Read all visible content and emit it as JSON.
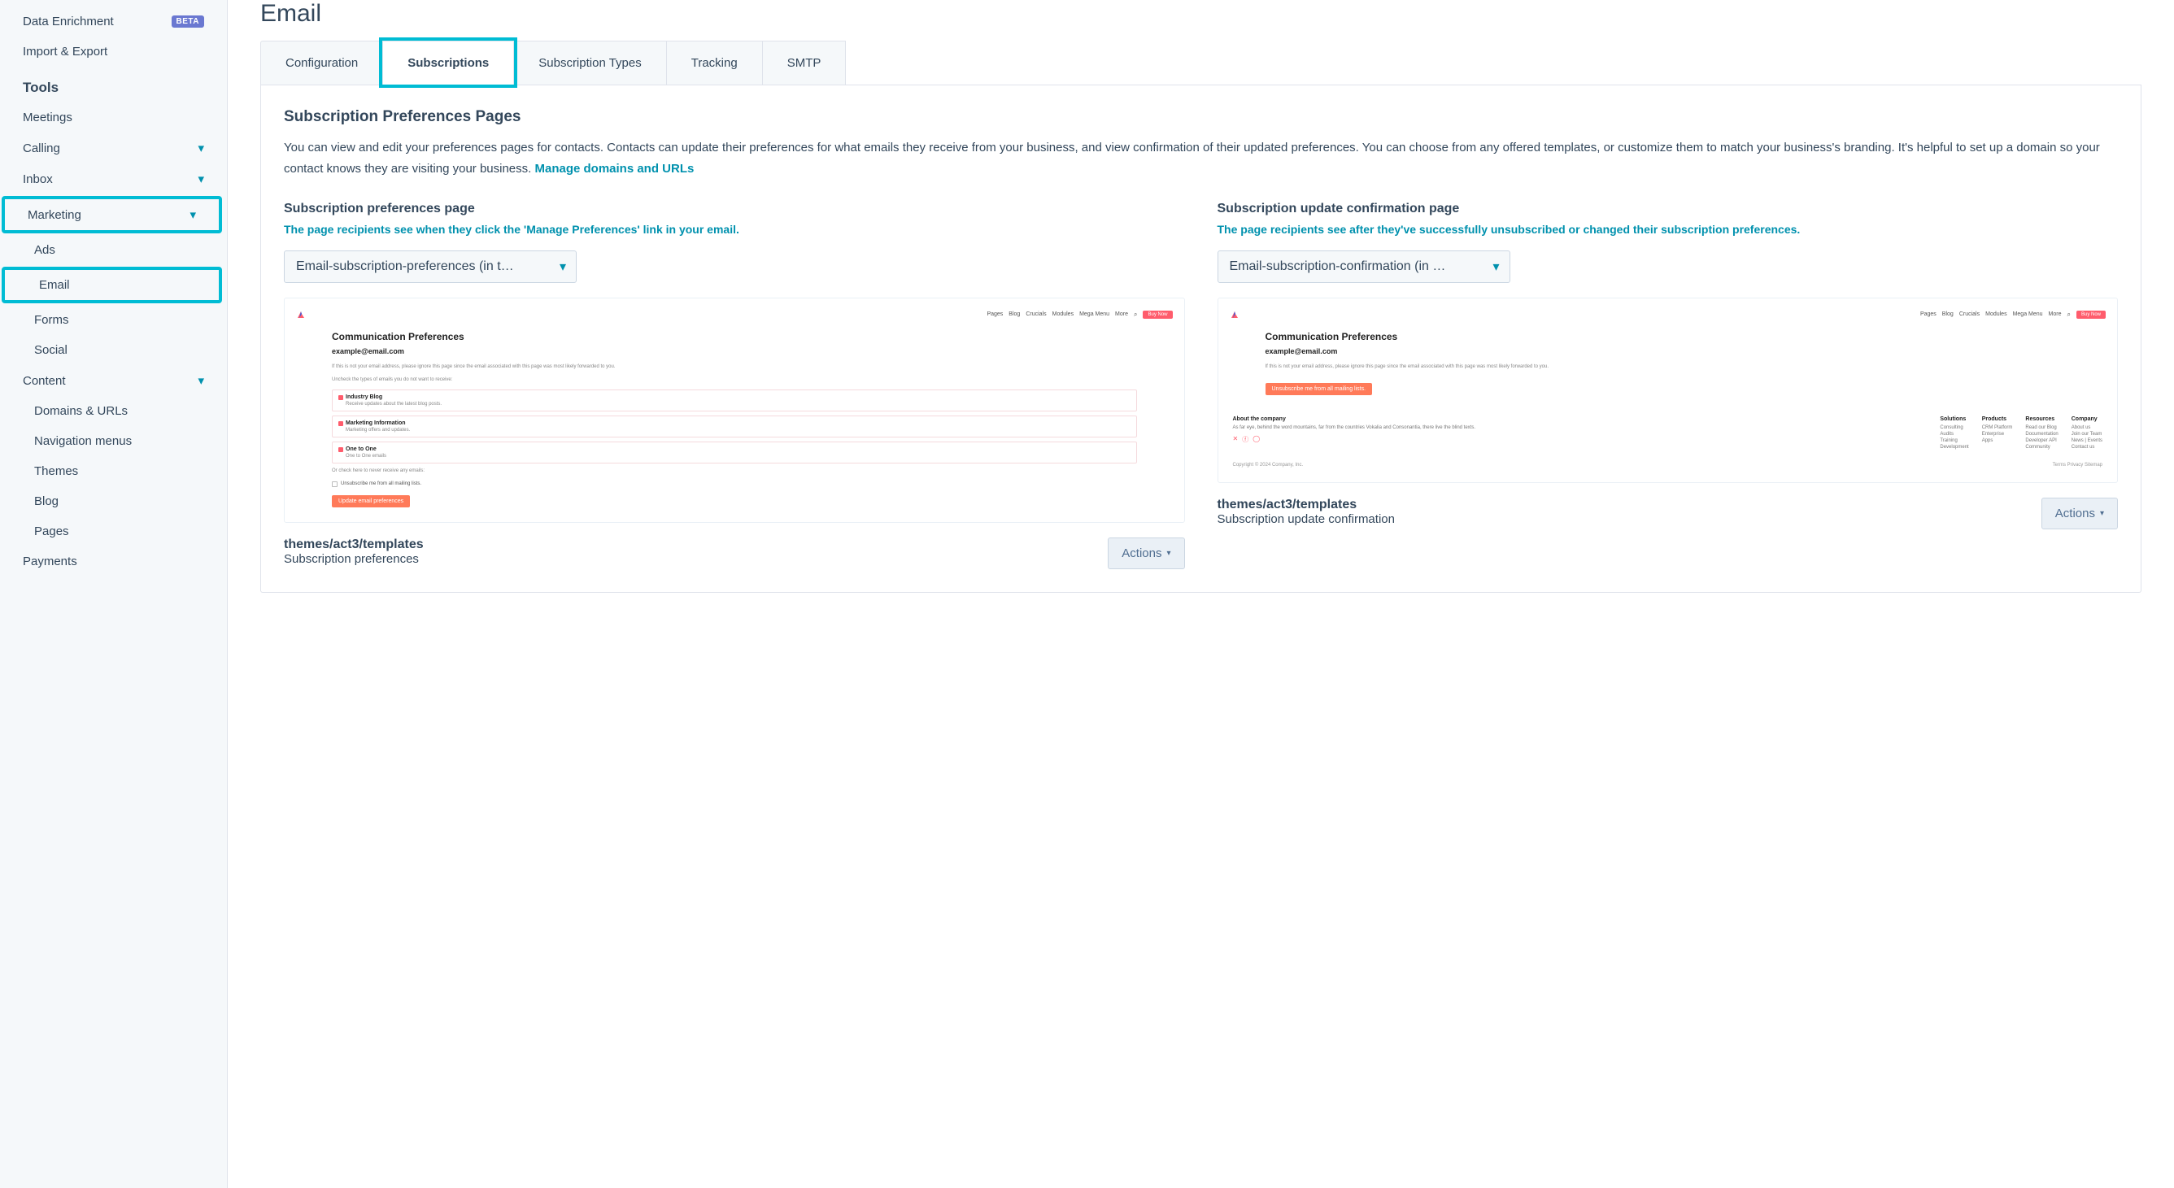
{
  "sidebar": {
    "dataEnrichment": "Data Enrichment",
    "betaBadge": "BETA",
    "importExport": "Import & Export",
    "toolsHeading": "Tools",
    "meetings": "Meetings",
    "calling": "Calling",
    "inbox": "Inbox",
    "marketing": "Marketing",
    "ads": "Ads",
    "email": "Email",
    "forms": "Forms",
    "social": "Social",
    "content": "Content",
    "domainsUrls": "Domains & URLs",
    "navMenus": "Navigation menus",
    "themes": "Themes",
    "blog": "Blog",
    "pages": "Pages",
    "payments": "Payments"
  },
  "page": {
    "title": "Email"
  },
  "tabs": {
    "configuration": "Configuration",
    "subscriptions": "Subscriptions",
    "subscriptionTypes": "Subscription Types",
    "tracking": "Tracking",
    "smtp": "SMTP"
  },
  "section": {
    "title": "Subscription Preferences Pages",
    "desc": "You can view and edit your preferences pages for contacts. Contacts can update their preferences for what emails they receive from your business, and view confirmation of their updated preferences. You can choose from any offered templates, or customize them to match your business's branding. It's helpful to set up a domain so your contact knows they are visiting your business. ",
    "manageLink": "Manage domains and URLs"
  },
  "left": {
    "title": "Subscription preferences page",
    "desc": "The page recipients see when they click the 'Manage Preferences' link in your email.",
    "select": "Email-subscription-preferences (in t…",
    "pathLine1": "themes/act3/templates",
    "pathLine2": "Subscription preferences",
    "actions": "Actions"
  },
  "right": {
    "title": "Subscription update confirmation page",
    "desc": "The page recipients see after they've successfully unsubscribed or changed their subscription preferences.",
    "select": "Email-subscription-confirmation (in …",
    "pathLine1": "themes/act3/templates",
    "pathLine2": "Subscription update confirmation",
    "actions": "Actions"
  },
  "preview": {
    "navItems": [
      "Pages",
      "Blog",
      "Crucials",
      "Modules",
      "Mega Menu",
      "More"
    ],
    "buyNow": "Buy Now",
    "heading": "Communication Preferences",
    "email": "example@email.com",
    "fine1": "If this is not your email address, please ignore this page since the email associated with this page was most likely forwarded to you.",
    "fine2": "Uncheck the types of emails you do not want to receive:",
    "card1t": "Industry Blog",
    "card1d": "Receive updates about the latest blog posts.",
    "card2t": "Marketing Information",
    "card2d": "Marketing offers and updates.",
    "card3t": "One to One",
    "card3d": "One to One emails",
    "orCheck": "Or check here to never receive any emails:",
    "unsubAll": "Unsubscribe me from all mailing lists.",
    "updateBtn": "Update email preferences",
    "unsubBtn": "Unsubscribe me from all mailing lists.",
    "footAboutH": "About the company",
    "footAboutT": "As far eye, behind the word mountains, far from the countries Vokalia and Consonantia, there live the blind texts.",
    "footSolH": "Solutions",
    "footSol": [
      "Consulting",
      "Audits",
      "Training",
      "Development"
    ],
    "footProdH": "Products",
    "footProd": [
      "CRM Platform",
      "Enterprise",
      "Apps"
    ],
    "footResH": "Resources",
    "footRes": [
      "Read our Blog",
      "Documentation",
      "Developer API",
      "Community"
    ],
    "footCompH": "Company",
    "footComp": [
      "About us",
      "Join our Team",
      "News | Events",
      "Contact us"
    ],
    "copyright": "Copyright © 2024 Company, Inc.",
    "copyLinks": "Terms   Privacy   Sitemap"
  }
}
